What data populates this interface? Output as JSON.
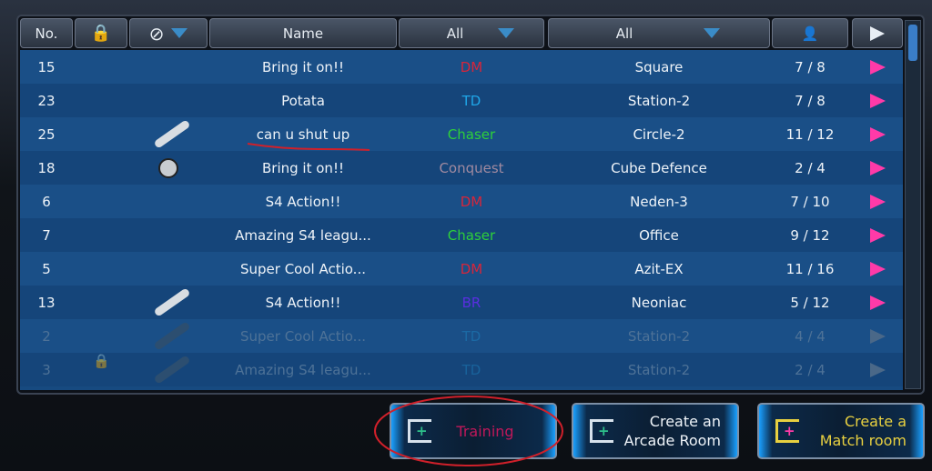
{
  "header": {
    "no": "No.",
    "name": "Name",
    "mode_filter": "All",
    "map_filter": "All",
    "lock_icon": "lock-icon",
    "password_filter_icon": "no-entry-icon",
    "players_icon": "person-icon",
    "play_icon": "play-icon"
  },
  "colors": {
    "DM": "#d8253a",
    "TD": "#1fa6e8",
    "Chaser": "#2ed03a",
    "Conquest": "#a08aa0",
    "BR": "#5a2ee0",
    "play": "#ff3aa8"
  },
  "rooms": [
    {
      "no": "15",
      "icon": "",
      "name": "Bring it on!!",
      "mode": "DM",
      "map": "Square",
      "players": "7 / 8",
      "dim": false
    },
    {
      "no": "23",
      "icon": "",
      "name": "Potata",
      "mode": "TD",
      "map": "Station-2",
      "players": "7 / 8",
      "dim": false
    },
    {
      "no": "25",
      "icon": "wrench",
      "name": "can u shut up",
      "mode": "Chaser",
      "map": "Circle-2",
      "players": "11 / 12",
      "dim": false
    },
    {
      "no": "18",
      "icon": "coin",
      "name": "Bring it on!!",
      "mode": "Conquest",
      "map": "Cube Defence",
      "players": "2 / 4",
      "dim": false
    },
    {
      "no": "6",
      "icon": "",
      "name": "S4 Action!!",
      "mode": "DM",
      "map": "Neden-3",
      "players": "7 / 10",
      "dim": false
    },
    {
      "no": "7",
      "icon": "",
      "name": "Amazing S4 leagu...",
      "mode": "Chaser",
      "map": "Office",
      "players": "9 / 12",
      "dim": false
    },
    {
      "no": "5",
      "icon": "",
      "name": "Super Cool Actio...",
      "mode": "DM",
      "map": "Azit-EX",
      "players": "11 / 16",
      "dim": false
    },
    {
      "no": "13",
      "icon": "wrench",
      "name": "S4 Action!!",
      "mode": "BR",
      "map": "Neoniac",
      "players": "5 / 12",
      "dim": false
    },
    {
      "no": "2",
      "icon": "wrench",
      "name": "Super Cool Actio...",
      "mode": "TD",
      "map": "Station-2",
      "players": "4 / 4",
      "dim": true
    },
    {
      "no": "3",
      "icon": "lock+wrench",
      "name": "Amazing S4 leagu...",
      "mode": "TD",
      "map": "Station-2",
      "players": "2 / 4",
      "dim": true
    }
  ],
  "buttons": {
    "training": "Training",
    "arcade": "Create an Arcade Room",
    "match": "Create a Match room"
  }
}
